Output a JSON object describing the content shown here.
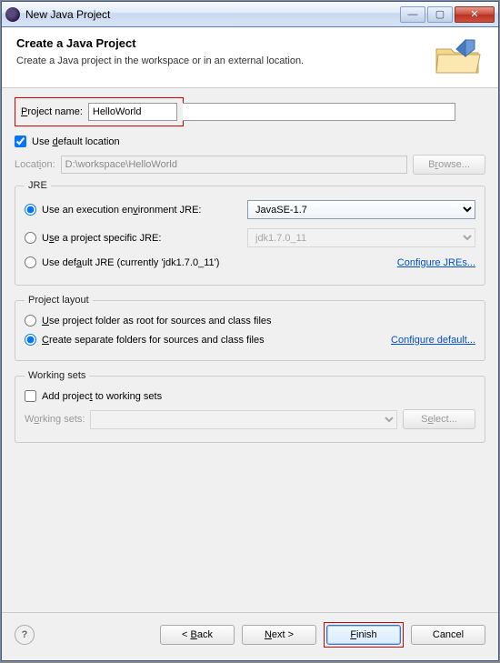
{
  "window": {
    "title": "New Java Project"
  },
  "header": {
    "title": "Create a Java Project",
    "subtitle": "Create a Java project in the workspace or in an external location."
  },
  "projectName": {
    "label": "Project name:",
    "value": "HelloWorld"
  },
  "location": {
    "useDefaultLabel": "Use default location",
    "useDefaultChecked": true,
    "label": "Location:",
    "value": "D:\\workspace\\HelloWorld",
    "browseLabel": "Browse..."
  },
  "jre": {
    "legend": "JRE",
    "execEnvLabel": "Use an execution environment JRE:",
    "execEnvValue": "JavaSE-1.7",
    "projectJreLabel": "Use a project specific JRE:",
    "projectJreValue": "jdk1.7.0_11",
    "defaultJreLabel": "Use default JRE (currently 'jdk1.7.0_11')",
    "configureLink": "Configure JREs...",
    "selected": "execEnv"
  },
  "layout": {
    "legend": "Project layout",
    "rootLabel": "Use project folder as root for sources and class files",
    "separateLabel": "Create separate folders for sources and class files",
    "configureLink": "Configure default...",
    "selected": "separate"
  },
  "workingSets": {
    "legend": "Working sets",
    "addLabel": "Add project to working sets",
    "addChecked": false,
    "label": "Working sets:",
    "selectLabel": "Select..."
  },
  "footer": {
    "back": "< Back",
    "next": "Next >",
    "finish": "Finish",
    "cancel": "Cancel"
  }
}
